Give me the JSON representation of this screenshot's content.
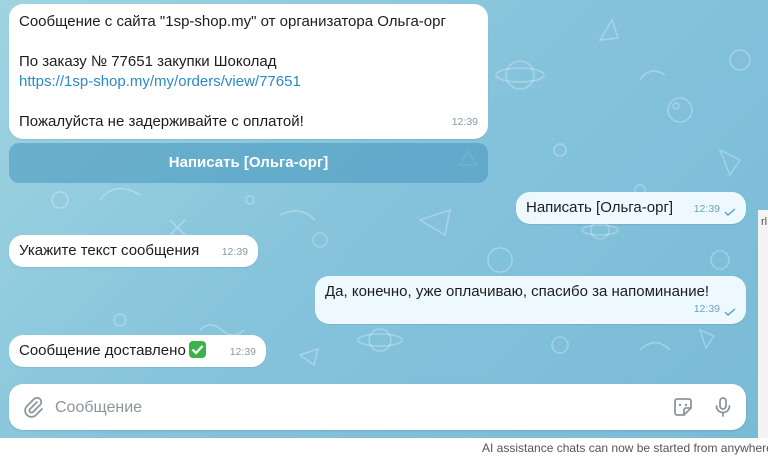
{
  "messages": {
    "m1": {
      "line1": "Сообщение с сайта \"1sp-shop.my\" от организатора Ольга-орг",
      "line2": "По заказу № 77651 закупки Шоколад",
      "link": "https://1sp-shop.my/my/orders/view/77651",
      "line3": "Пожалуйста не задерживайте с оплатой!",
      "time": "12:39"
    },
    "inline_button": "Написать [Ольга-орг]",
    "m2": {
      "text": "Написать [Ольга-орг]",
      "time": "12:39"
    },
    "m3": {
      "text": "Укажите текст сообщения",
      "time": "12:39"
    },
    "m4": {
      "text": "Да, конечно, уже оплачиваю, спасибо за напоминание!",
      "time": "12:39"
    },
    "m5": {
      "text": "Сообщение доставлено",
      "time": "12:39"
    }
  },
  "composer": {
    "placeholder": "Сообщение",
    "value": ""
  },
  "icons": {
    "attach": "paperclip-icon",
    "sticker": "sticker-icon",
    "mic": "microphone-icon",
    "read": "check-icon",
    "delivered_emoji": "white-check-mark-emoji"
  },
  "footer": {
    "hint": "AI assistance chats can now be started from anywhere"
  },
  "edge": {
    "text": "rl"
  },
  "colors": {
    "incoming_bubble": "#ffffff",
    "outgoing_bubble": "#eef9ff",
    "link": "#2b8ac8",
    "inline_button_bg": "#4696be",
    "check_emoji": "#3bb24a"
  }
}
